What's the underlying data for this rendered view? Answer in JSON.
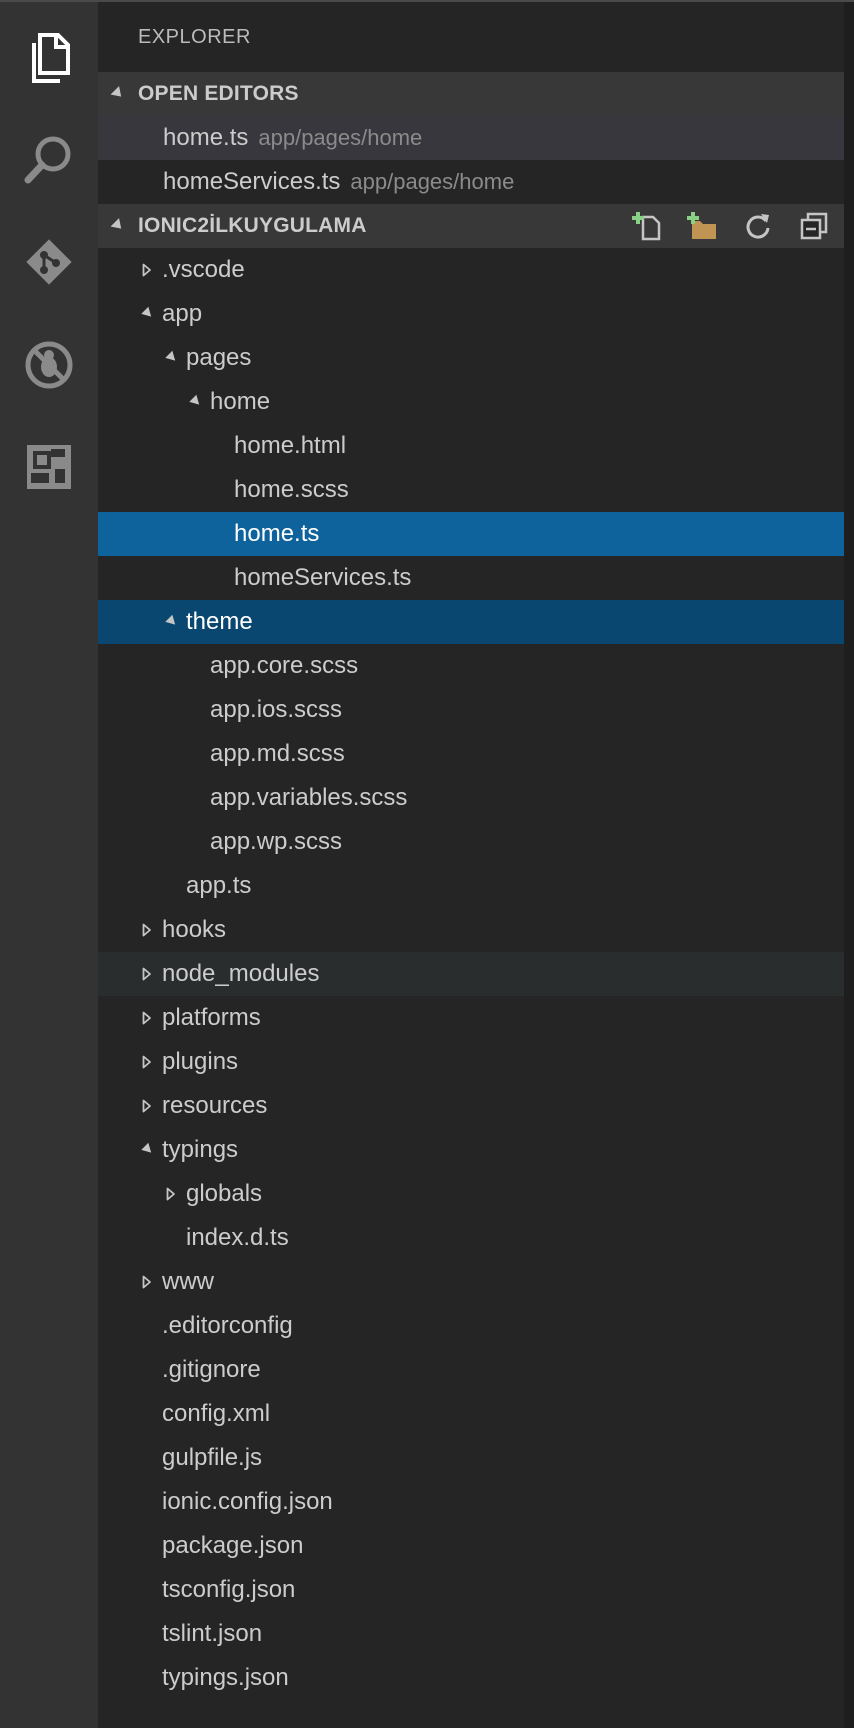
{
  "explorer": {
    "title": "EXPLORER"
  },
  "open_editors": {
    "header": "OPEN EDITORS",
    "items": [
      {
        "name": "home.ts",
        "path": "app/pages/home"
      },
      {
        "name": "homeServices.ts",
        "path": "app/pages/home"
      }
    ]
  },
  "project": {
    "header": "IONIC2İLKUYGULAMA",
    "tree": [
      {
        "label": ".vscode",
        "type": "folder",
        "expanded": false
      },
      {
        "label": "app",
        "type": "folder",
        "expanded": true
      },
      {
        "label": "pages",
        "type": "folder",
        "expanded": true
      },
      {
        "label": "home",
        "type": "folder",
        "expanded": true
      },
      {
        "label": "home.html",
        "type": "file"
      },
      {
        "label": "home.scss",
        "type": "file"
      },
      {
        "label": "home.ts",
        "type": "file"
      },
      {
        "label": "homeServices.ts",
        "type": "file"
      },
      {
        "label": "theme",
        "type": "folder",
        "expanded": true
      },
      {
        "label": "app.core.scss",
        "type": "file"
      },
      {
        "label": "app.ios.scss",
        "type": "file"
      },
      {
        "label": "app.md.scss",
        "type": "file"
      },
      {
        "label": "app.variables.scss",
        "type": "file"
      },
      {
        "label": "app.wp.scss",
        "type": "file"
      },
      {
        "label": "app.ts",
        "type": "file"
      },
      {
        "label": "hooks",
        "type": "folder",
        "expanded": false
      },
      {
        "label": "node_modules",
        "type": "folder",
        "expanded": false
      },
      {
        "label": "platforms",
        "type": "folder",
        "expanded": false
      },
      {
        "label": "plugins",
        "type": "folder",
        "expanded": false
      },
      {
        "label": "resources",
        "type": "folder",
        "expanded": false
      },
      {
        "label": "typings",
        "type": "folder",
        "expanded": true
      },
      {
        "label": "globals",
        "type": "folder",
        "expanded": false
      },
      {
        "label": "index.d.ts",
        "type": "file"
      },
      {
        "label": "www",
        "type": "folder",
        "expanded": false
      },
      {
        "label": ".editorconfig",
        "type": "file"
      },
      {
        "label": ".gitignore",
        "type": "file"
      },
      {
        "label": "config.xml",
        "type": "file"
      },
      {
        "label": "gulpfile.js",
        "type": "file"
      },
      {
        "label": "ionic.config.json",
        "type": "file"
      },
      {
        "label": "package.json",
        "type": "file"
      },
      {
        "label": "tsconfig.json",
        "type": "file"
      },
      {
        "label": "tslint.json",
        "type": "file"
      },
      {
        "label": "typings.json",
        "type": "file"
      }
    ]
  },
  "icons": {
    "activity": [
      "files-icon",
      "search-icon",
      "git-icon",
      "debug-icon",
      "extensions-icon"
    ],
    "header_actions": [
      "new-file-icon",
      "new-folder-icon",
      "refresh-icon",
      "collapse-all-icon"
    ]
  },
  "colors": {
    "selection": "#0e639c",
    "focus_folder": "#094771",
    "activity_bar": "#333333",
    "sidebar": "#252526"
  }
}
